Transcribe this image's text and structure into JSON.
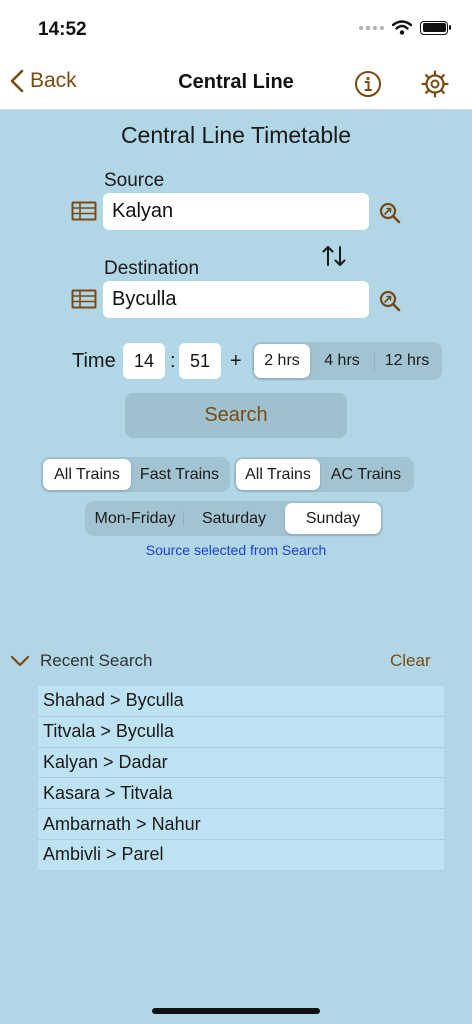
{
  "status_bar": {
    "time": "14:52"
  },
  "nav": {
    "back_label": "Back",
    "title": "Central Line",
    "info_icon": "info-icon",
    "settings_icon": "gear-icon"
  },
  "page": {
    "heading": "Central Line Timetable"
  },
  "source": {
    "label": "Source",
    "value": "Kalyan"
  },
  "destination": {
    "label": "Destination",
    "value": "Byculla"
  },
  "time": {
    "label": "Time",
    "hour": "14",
    "separator": ":",
    "minute": "51",
    "plus": "+",
    "durations": [
      "2 hrs",
      "4 hrs",
      "12 hrs"
    ],
    "selected_duration": "2 hrs"
  },
  "search": {
    "label": "Search"
  },
  "filters": {
    "speed": [
      "All Trains",
      "Fast Trains"
    ],
    "speed_selected": "All Trains",
    "type": [
      "All Trains",
      "AC Trains"
    ],
    "type_selected": "All Trains",
    "days": [
      "Mon-Friday",
      "Saturday",
      "Sunday"
    ],
    "days_selected": "Sunday"
  },
  "hint": "Source selected from Search",
  "recent": {
    "title": "Recent Search",
    "clear_label": "Clear",
    "items": [
      "Shahad > Byculla",
      "Titvala > Byculla",
      "Kalyan > Dadar",
      "Kasara > Titvala",
      "Ambarnath > Nahur",
      "Ambivli > Parel"
    ]
  },
  "colors": {
    "accent": "#7b4a12",
    "background": "#b1d6e5",
    "hint": "#1c3fd0",
    "list_item": "#bde2f1"
  }
}
